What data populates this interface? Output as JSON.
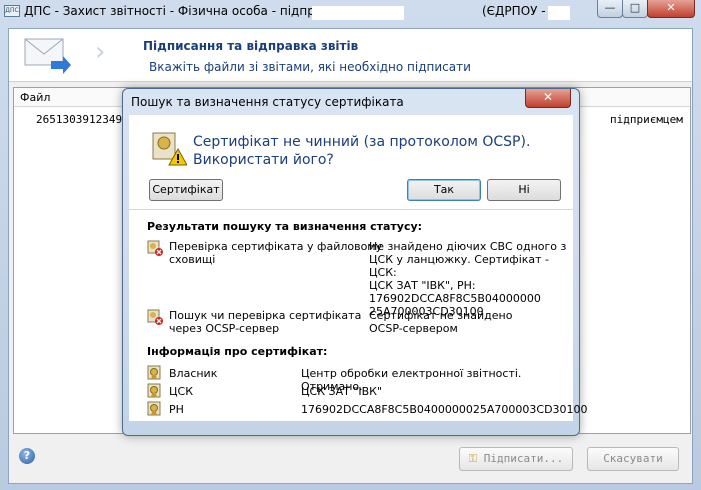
{
  "window": {
    "app_icon": "ДПС",
    "title": "ДПС - Захист звітності - Фізична особа - підприємець І",
    "title_right": "(ЄДРПОУ -    2...",
    "minimize": "—",
    "maximize": "□",
    "close": "✕"
  },
  "header": {
    "title": "Підписання та відправка звітів",
    "subtitle": "Вкажіть файли зі звітами, які необхідно підписати"
  },
  "table": {
    "column_file": "Файл",
    "row_file": "26513039123490",
    "row_desc": "підприємцем"
  },
  "footer": {
    "help": "?",
    "sign_button": "Підписати...",
    "cancel_button": "Скасувати"
  },
  "dialog": {
    "title": "Пошук та визначення статусу сертифіката",
    "close": "✕",
    "question_line1": "Сертифікат не чинний (за протоколом OCSP).",
    "question_line2": "Використати його?",
    "cert_button": "Сертифікат",
    "yes_button": "Так",
    "no_button": "Ні",
    "results_heading": "Результати пошуку та визначення статусу:",
    "results": [
      {
        "icon": "cert-error-icon",
        "label_lines": [
          "Перевірка сертифіката у файловому",
          "сховищі"
        ],
        "value_lines": [
          "Не знайдено діючих СВС одного з",
          "ЦСК у ланцюжку. Сертифікат - ЦСК:",
          "ЦСК ЗАТ \"ІВК\", РН:",
          "176902DCCA8F8C5B04000000",
          "25A700003CD30100"
        ]
      },
      {
        "icon": "cert-error-icon",
        "label_lines": [
          "Пошук чи перевірка сертифіката",
          "через OCSP-сервер"
        ],
        "value_lines": [
          "Сертифікат не знайдено",
          "OCSP-сервером"
        ]
      }
    ],
    "info_heading": "Інформація про сертифікат:",
    "info": [
      {
        "label": "Власник",
        "value": "Центр обробки електронної звітності. Отримано."
      },
      {
        "label": "ЦСК",
        "value": "ЦСК ЗАТ \"ІВК\""
      },
      {
        "label": "РН",
        "value": "176902DCCA8F8C5B0400000025A700003CD30100"
      }
    ]
  }
}
